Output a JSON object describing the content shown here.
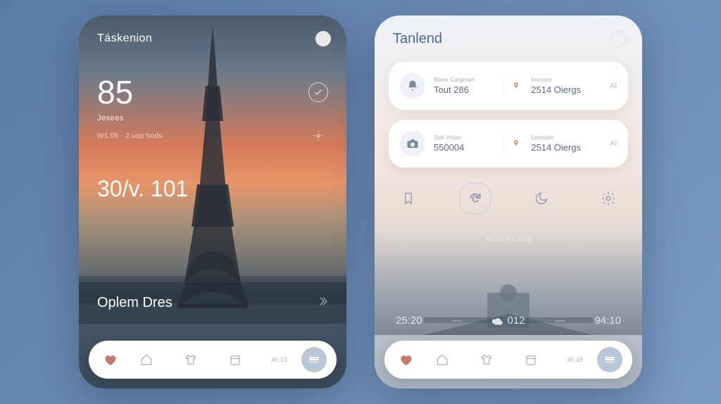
{
  "left": {
    "title": "Táskenion",
    "main_number": "85",
    "main_sub": "Jesees",
    "main_sub2": "W1.06 · 2 uop bods",
    "mid_value": "30/v. 101",
    "section_title": "Oplem Dres",
    "nav_label": "46:13"
  },
  "right": {
    "title": "Tanlend",
    "cards": [
      {
        "col1_top": "Rarie Cargnian",
        "col1_bot": "Tout 286",
        "col2_top": "Irorrism",
        "col2_bot": "2514 Oiergs",
        "end": "Al"
      },
      {
        "col1_top": "Solt Voion",
        "col1_bot": "550004",
        "col2_top": "Leenism",
        "col2_bot": "2514 Oiergs",
        "end": "Al"
      }
    ],
    "caption": "Terterk Linse",
    "times": {
      "t1": "25:20",
      "t2": "012",
      "t3": "94:10"
    },
    "nav_label": "45.18"
  }
}
